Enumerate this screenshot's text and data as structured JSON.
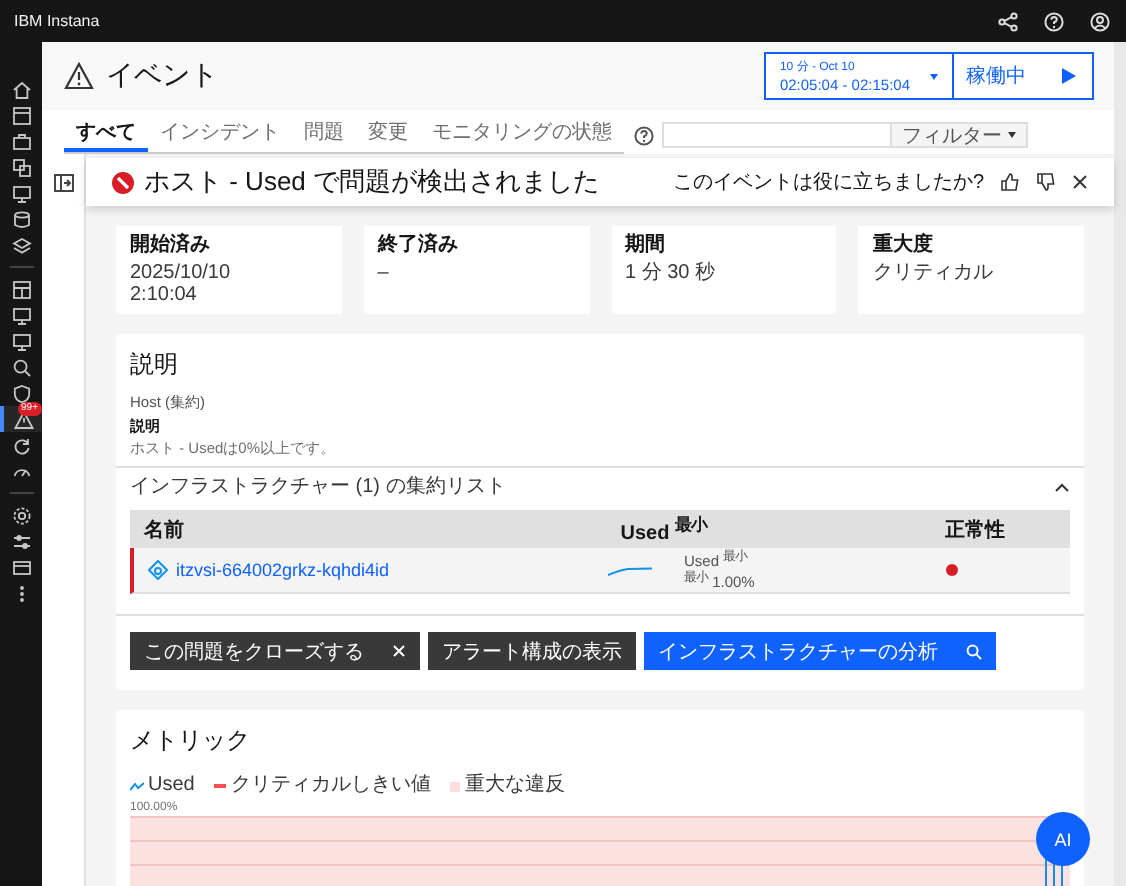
{
  "topbar": {
    "brand": "IBM Instana"
  },
  "sidebar": {
    "groups": [
      [
        {
          "selected": false
        },
        {
          "selected": false
        },
        {
          "selected": false
        },
        {
          "selected": false
        },
        {
          "selected": false
        },
        {
          "selected": false
        },
        {
          "selected": false
        }
      ],
      [
        {
          "selected": false
        },
        {
          "selected": false
        },
        {
          "selected": false
        },
        {
          "selected": false
        },
        {
          "selected": false
        },
        {
          "selected": true,
          "badge": "99+"
        },
        {
          "selected": false
        },
        {
          "selected": false
        }
      ],
      [
        {
          "selected": false
        },
        {
          "selected": false
        },
        {
          "selected": false
        },
        {
          "selected": false
        }
      ]
    ]
  },
  "header": {
    "title": "イベント",
    "time_range": {
      "label": "10 分 - Oct 10",
      "range": "02:05:04 - 02:15:04"
    },
    "live_button": "稼働中"
  },
  "tabs": [
    {
      "label": "すべて",
      "selected": true
    },
    {
      "label": "インシデント",
      "selected": false
    },
    {
      "label": "問題",
      "selected": false
    },
    {
      "label": "変更",
      "selected": false
    },
    {
      "label": "モニタリングの状態",
      "selected": false
    }
  ],
  "filter": {
    "dropdown": "フィルター"
  },
  "banner": {
    "title": "ホスト - Used で問題が検出されました",
    "feedback": "このイベントは役に立ちましたか?"
  },
  "summary": [
    {
      "label": "開始済み",
      "value": "2025/10/10\n2:10:04"
    },
    {
      "label": "終了済み",
      "value": "–"
    },
    {
      "label": "期間",
      "value": "1 分 30 秒"
    },
    {
      "label": "重大度",
      "value": "クリティカル"
    }
  ],
  "description": {
    "title": "説明",
    "scope": "Host (集約)",
    "heading": "説明",
    "text": "ホスト - Usedは0%以上です。"
  },
  "infrastructure": {
    "title": "インフラストラクチャー (1) の集約リスト",
    "expanded": true,
    "columns": [
      "名前",
      "Used $^{最小}$",
      "正常性"
    ],
    "rows": [
      {
        "name": "itzvsi-664002grkz-kqhdi4id",
        "used_label": "Used $^{最小}$",
        "used_value": "$^{最小}$ 1.00%",
        "health": {
          "color": "#da1e28"
        }
      }
    ]
  },
  "actions": [
    {
      "label": "この問題をクローズする",
      "kind": "close"
    },
    {
      "label": "アラート構成の表示",
      "kind": "plain"
    },
    {
      "label": "インフラストラクチャーの分析",
      "kind": "analyze"
    }
  ],
  "metrics": {
    "title": "メトリック",
    "legend": [
      {
        "label": "Used",
        "kind": "line",
        "color": "#1192e8"
      },
      {
        "label": "クリティカルしきい値",
        "kind": "dash",
        "color": "#fa4d56"
      },
      {
        "label": "重大な違反",
        "kind": "area",
        "color": "#fcdcdc"
      }
    ],
    "y_tick_label": "100.00%"
  },
  "assistant": {
    "label": "AI"
  }
}
